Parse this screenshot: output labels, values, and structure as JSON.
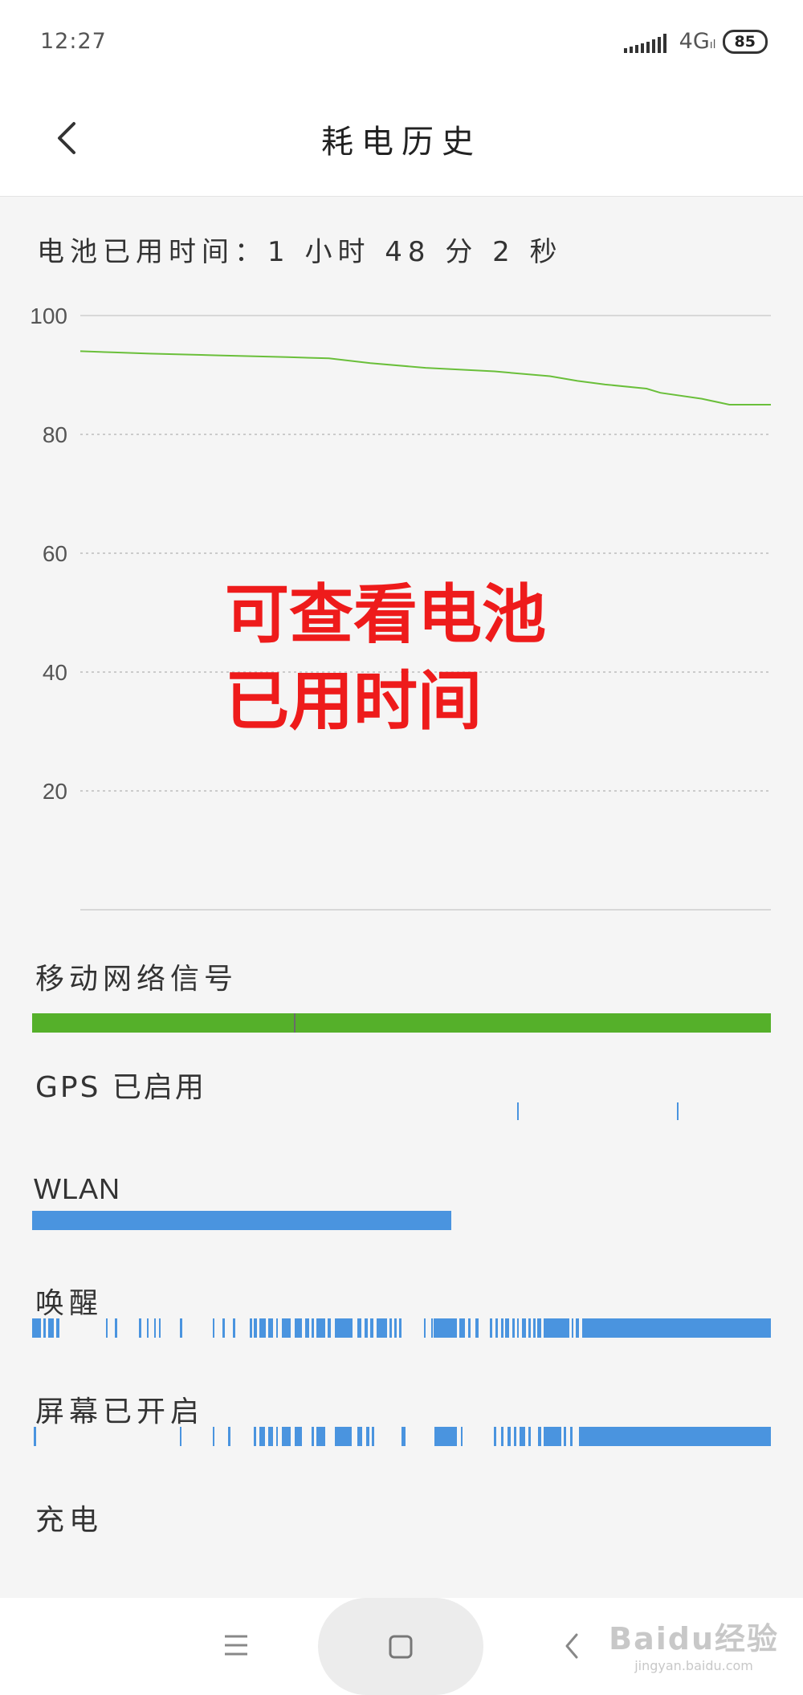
{
  "status_bar": {
    "time": "12:27",
    "network": "4G",
    "network_sub": "ıl",
    "battery": "85"
  },
  "header": {
    "title": "耗电历史"
  },
  "usage_text": "电池已用时间：1 小时 48 分 2 秒",
  "chart_data": {
    "type": "line",
    "title": "",
    "y_ticks": [
      "100",
      "80",
      "60",
      "40",
      "20"
    ],
    "ylim": [
      0,
      100
    ],
    "grid": true,
    "x": [
      0,
      0.05,
      0.1,
      0.2,
      0.3,
      0.36,
      0.42,
      0.5,
      0.6,
      0.68,
      0.72,
      0.76,
      0.82,
      0.84,
      0.9,
      0.94,
      0.97,
      1.0
    ],
    "series": [
      {
        "values": [
          94,
          93.8,
          93.6,
          93.3,
          93.0,
          92.8,
          92.0,
          91.2,
          90.6,
          89.8,
          89.0,
          88.4,
          87.7,
          87.0,
          86.0,
          85.0,
          85.0,
          85.0
        ],
        "color": "#6abf3a"
      }
    ]
  },
  "annotation": {
    "line1": "可查看电池",
    "line2": "已用时间"
  },
  "sections": {
    "mobile_signal": {
      "label": "移动网络信号",
      "color": "#55b02a"
    },
    "gps": {
      "label": "GPS 已启用",
      "color": "#4a94df"
    },
    "wlan": {
      "label": "WLAN",
      "color": "#4a94df"
    },
    "wake": {
      "label": "唤醒",
      "color": "#4a94df"
    },
    "screen": {
      "label": "屏幕已开启",
      "color": "#4a94df"
    },
    "charging": {
      "label": "充电"
    }
  },
  "timelines": {
    "gps": [
      [
        0.657,
        0.003
      ],
      [
        0.873,
        0.003
      ]
    ],
    "wlan": [
      [
        0.0,
        0.567
      ]
    ],
    "wake": [
      [
        0.0,
        0.012
      ],
      [
        0.015,
        0.004
      ],
      [
        0.022,
        0.007
      ],
      [
        0.033,
        0.004
      ],
      [
        0.1,
        0.002
      ],
      [
        0.112,
        0.003
      ],
      [
        0.145,
        0.003
      ],
      [
        0.155,
        0.002
      ],
      [
        0.165,
        0.002
      ],
      [
        0.172,
        0.002
      ],
      [
        0.2,
        0.003
      ],
      [
        0.245,
        0.002
      ],
      [
        0.258,
        0.003
      ],
      [
        0.272,
        0.003
      ],
      [
        0.295,
        0.003
      ],
      [
        0.3,
        0.004
      ],
      [
        0.308,
        0.008
      ],
      [
        0.32,
        0.006
      ],
      [
        0.33,
        0.003
      ],
      [
        0.338,
        0.012
      ],
      [
        0.355,
        0.01
      ],
      [
        0.37,
        0.005
      ],
      [
        0.378,
        0.004
      ],
      [
        0.385,
        0.012
      ],
      [
        0.4,
        0.004
      ],
      [
        0.41,
        0.024
      ],
      [
        0.44,
        0.006
      ],
      [
        0.45,
        0.004
      ],
      [
        0.458,
        0.004
      ],
      [
        0.466,
        0.014
      ],
      [
        0.484,
        0.003
      ],
      [
        0.49,
        0.003
      ],
      [
        0.497,
        0.003
      ],
      [
        0.53,
        0.003
      ],
      [
        0.5435,
        0.001
      ],
      [
        0.56,
        0.002
      ],
      [
        0.54,
        0.001
      ],
      [
        0.545,
        0.03
      ],
      [
        0.578,
        0.008
      ],
      [
        0.59,
        0.004
      ],
      [
        0.6,
        0.004
      ],
      [
        0.62,
        0.003
      ],
      [
        0.627,
        0.003
      ],
      [
        0.635,
        0.003
      ],
      [
        0.64,
        0.006
      ],
      [
        0.65,
        0.003
      ],
      [
        0.656,
        0.003
      ],
      [
        0.663,
        0.006
      ],
      [
        0.672,
        0.003
      ],
      [
        0.678,
        0.003
      ],
      [
        0.684,
        0.005
      ],
      [
        0.692,
        0.035
      ],
      [
        0.73,
        0.003
      ],
      [
        0.736,
        0.004
      ],
      [
        0.745,
        0.255
      ]
    ],
    "screen": [
      [
        0.002,
        0.003
      ],
      [
        0.2,
        0.002
      ],
      [
        0.245,
        0.002
      ],
      [
        0.265,
        0.003
      ],
      [
        0.3,
        0.003
      ],
      [
        0.308,
        0.007
      ],
      [
        0.32,
        0.006
      ],
      [
        0.33,
        0.003
      ],
      [
        0.338,
        0.012
      ],
      [
        0.355,
        0.01
      ],
      [
        0.378,
        0.004
      ],
      [
        0.385,
        0.012
      ],
      [
        0.41,
        0.023
      ],
      [
        0.44,
        0.007
      ],
      [
        0.452,
        0.004
      ],
      [
        0.46,
        0.003
      ],
      [
        0.5,
        0.005
      ],
      [
        0.545,
        0.03
      ],
      [
        0.58,
        0.003
      ],
      [
        0.625,
        0.003
      ],
      [
        0.635,
        0.003
      ],
      [
        0.643,
        0.005
      ],
      [
        0.652,
        0.003
      ],
      [
        0.66,
        0.007
      ],
      [
        0.672,
        0.003
      ],
      [
        0.685,
        0.004
      ],
      [
        0.692,
        0.024
      ],
      [
        0.72,
        0.003
      ],
      [
        0.728,
        0.004
      ],
      [
        0.74,
        0.26
      ]
    ]
  },
  "nav": {
    "menu_icon": "menu-icon",
    "home_icon": "home-square-icon",
    "back_icon": "back-chevron-icon"
  },
  "watermark": {
    "line1": "Baidu经验",
    "line2": "jingyan.baidu.com"
  }
}
